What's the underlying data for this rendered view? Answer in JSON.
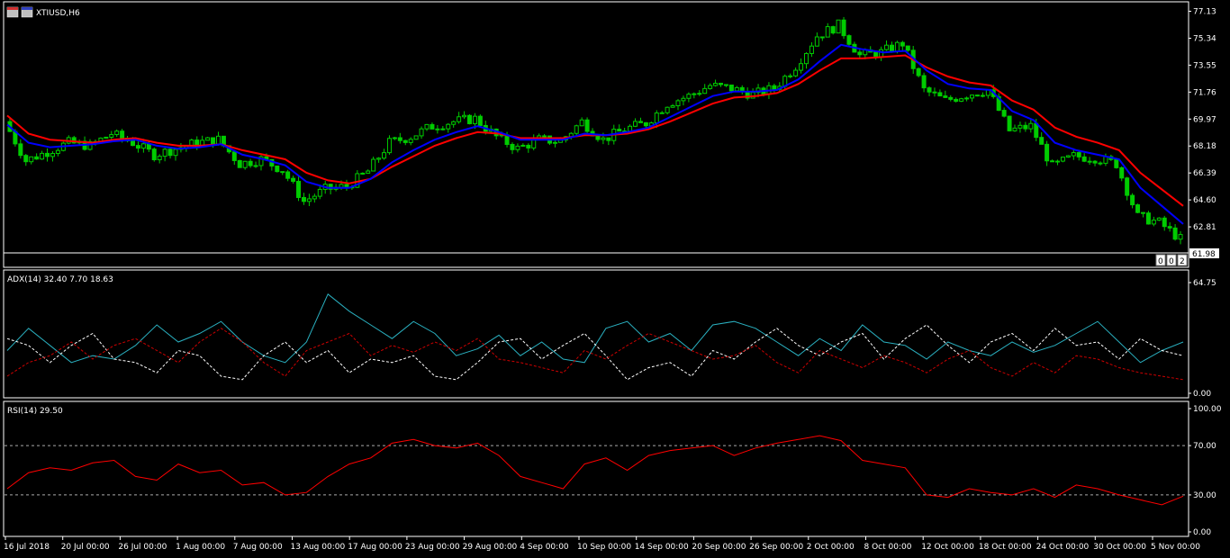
{
  "window": {
    "symbol_title": "XTIUSD,H6",
    "icons": [
      "window-menu-icon",
      "chart-type-icon"
    ]
  },
  "colors": {
    "background": "#000000",
    "frame": "#ffffff",
    "candle_up": "#00cc00",
    "candle_down": "#00cc00",
    "ma_fast": "#0000ff",
    "ma_slow": "#ff0000",
    "adx_main": "#2ab0c0",
    "adx_plus": "#ffffff",
    "adx_minus": "#cc0000",
    "rsi": "#ff0000",
    "level_line": "#aaaaaa"
  },
  "price_panel": {
    "axis_ticks": [
      "77.13",
      "75.34",
      "73.55",
      "71.76",
      "69.97",
      "68.18",
      "66.39",
      "64.60",
      "62.81"
    ],
    "ylim": [
      61.2,
      77.4
    ],
    "current_price_label": "61.98",
    "scroll_buttons": [
      "0",
      "0",
      "2"
    ]
  },
  "adx_panel": {
    "title": "ADX(14) 32.40 7.70 18.63",
    "axis_ticks": [
      "64.75",
      "0.00"
    ],
    "ylim": [
      0,
      64.75
    ]
  },
  "rsi_panel": {
    "title": "RSI(14) 29.50",
    "axis_ticks": [
      "100.00",
      "70.00",
      "30.00",
      "0.00"
    ],
    "levels": [
      70,
      30
    ],
    "ylim": [
      0,
      100
    ]
  },
  "time_axis": {
    "labels": [
      "16 Jul 2018",
      "20 Jul 00:00",
      "26 Jul 00:00",
      "1 Aug 00:00",
      "7 Aug 00:00",
      "13 Aug 00:00",
      "17 Aug 00:00",
      "23 Aug 00:00",
      "29 Aug 00:00",
      "4 Sep 00:00",
      "10 Sep 00:00",
      "14 Sep 00:00",
      "20 Sep 00:00",
      "26 Sep 00:00",
      "2 Oct 00:00",
      "8 Oct 00:00",
      "12 Oct 00:00",
      "18 Oct 00:00",
      "24 Oct 00:00",
      "30 Oct 00:00",
      "5 Nov 00:00"
    ]
  },
  "chart_data": {
    "type": "candlestick",
    "symbol": "XTIUSD",
    "timeframe": "H6",
    "x_label_dates": [
      "16 Jul 2018",
      "20 Jul 00:00",
      "26 Jul 00:00",
      "1 Aug 00:00",
      "7 Aug 00:00",
      "13 Aug 00:00",
      "17 Aug 00:00",
      "23 Aug 00:00",
      "29 Aug 00:00",
      "4 Sep 00:00",
      "10 Sep 00:00",
      "14 Sep 00:00",
      "20 Sep 00:00",
      "26 Sep 00:00",
      "2 Oct 00:00",
      "8 Oct 00:00",
      "12 Oct 00:00",
      "18 Oct 00:00",
      "24 Oct 00:00",
      "30 Oct 00:00",
      "5 Nov 00:00"
    ],
    "close_series": [
      69.8,
      67.2,
      67.8,
      68.4,
      68.2,
      69.0,
      68.4,
      67.6,
      68.0,
      68.4,
      68.6,
      67.0,
      67.3,
      66.6,
      64.5,
      65.3,
      65.5,
      66.5,
      68.4,
      68.8,
      69.5,
      69.8,
      70.0,
      68.8,
      68.0,
      68.6,
      68.5,
      69.8,
      68.6,
      69.3,
      69.7,
      71.0,
      71.5,
      72.2,
      72.0,
      71.6,
      72.0,
      73.5,
      75.5,
      76.2,
      74.2,
      74.4,
      75.0,
      71.9,
      71.2,
      71.6,
      71.9,
      69.2,
      69.5,
      66.8,
      67.5,
      67.4,
      67.0,
      63.5,
      63.1,
      62.0
    ],
    "ma_fast_series": [
      69.6,
      68.4,
      68.1,
      68.2,
      68.3,
      68.5,
      68.6,
      68.2,
      68.0,
      68.1,
      68.3,
      67.6,
      67.3,
      66.9,
      65.8,
      65.4,
      65.4,
      66.0,
      67.1,
      67.9,
      68.6,
      69.1,
      69.5,
      69.1,
      68.6,
      68.6,
      68.6,
      69.0,
      68.9,
      69.1,
      69.4,
      70.1,
      70.8,
      71.5,
      71.8,
      71.8,
      71.9,
      72.6,
      73.8,
      74.9,
      74.6,
      74.4,
      74.5,
      73.2,
      72.3,
      72.0,
      71.9,
      70.5,
      69.9,
      68.4,
      67.9,
      67.6,
      67.3,
      65.4,
      64.2,
      63.0
    ],
    "ma_slow_series": [
      70.2,
      69.0,
      68.6,
      68.5,
      68.4,
      68.6,
      68.7,
      68.4,
      68.2,
      68.2,
      68.3,
      67.9,
      67.6,
      67.3,
      66.4,
      65.9,
      65.7,
      66.0,
      66.8,
      67.5,
      68.2,
      68.7,
      69.1,
      69.0,
      68.7,
      68.7,
      68.7,
      68.9,
      68.9,
      69.0,
      69.3,
      69.8,
      70.4,
      71.0,
      71.4,
      71.5,
      71.7,
      72.3,
      73.2,
      74.0,
      74.0,
      74.1,
      74.2,
      73.4,
      72.8,
      72.4,
      72.2,
      71.2,
      70.6,
      69.4,
      68.8,
      68.4,
      67.9,
      66.4,
      65.3,
      64.2
    ],
    "adx_series": [
      25,
      38,
      28,
      18,
      22,
      20,
      28,
      40,
      30,
      35,
      42,
      30,
      22,
      18,
      30,
      58,
      48,
      40,
      32,
      42,
      35,
      22,
      26,
      34,
      22,
      30,
      20,
      18,
      38,
      42,
      30,
      35,
      25,
      40,
      42,
      38,
      30,
      22,
      32,
      25,
      40,
      30,
      28,
      20,
      30,
      25,
      22,
      30,
      24,
      28,
      35,
      42,
      30,
      18,
      25,
      30
    ],
    "adx_plus_series": [
      32,
      28,
      18,
      28,
      35,
      20,
      18,
      12,
      25,
      22,
      10,
      8,
      22,
      30,
      18,
      25,
      12,
      20,
      18,
      22,
      10,
      8,
      18,
      30,
      32,
      20,
      28,
      35,
      22,
      8,
      15,
      18,
      10,
      25,
      20,
      30,
      38,
      28,
      22,
      30,
      35,
      20,
      32,
      40,
      28,
      18,
      30,
      35,
      25,
      38,
      28,
      30,
      20,
      32,
      25,
      22
    ],
    "adx_minus_series": [
      10,
      18,
      22,
      30,
      20,
      28,
      32,
      25,
      18,
      30,
      38,
      30,
      18,
      10,
      25,
      30,
      35,
      22,
      28,
      24,
      30,
      25,
      32,
      20,
      18,
      15,
      12,
      25,
      20,
      28,
      35,
      30,
      25,
      20,
      22,
      28,
      18,
      12,
      25,
      20,
      15,
      22,
      18,
      12,
      20,
      25,
      15,
      10,
      18,
      12,
      22,
      20,
      15,
      12,
      10,
      8
    ],
    "rsi_series": [
      35,
      48,
      52,
      50,
      56,
      58,
      45,
      42,
      55,
      48,
      50,
      38,
      40,
      30,
      32,
      45,
      55,
      60,
      72,
      75,
      70,
      68,
      72,
      62,
      45,
      40,
      35,
      55,
      60,
      50,
      62,
      66,
      68,
      70,
      62,
      68,
      72,
      75,
      78,
      74,
      58,
      55,
      52,
      30,
      28,
      35,
      32,
      30,
      35,
      28,
      38,
      35,
      30,
      26,
      22,
      29
    ]
  }
}
